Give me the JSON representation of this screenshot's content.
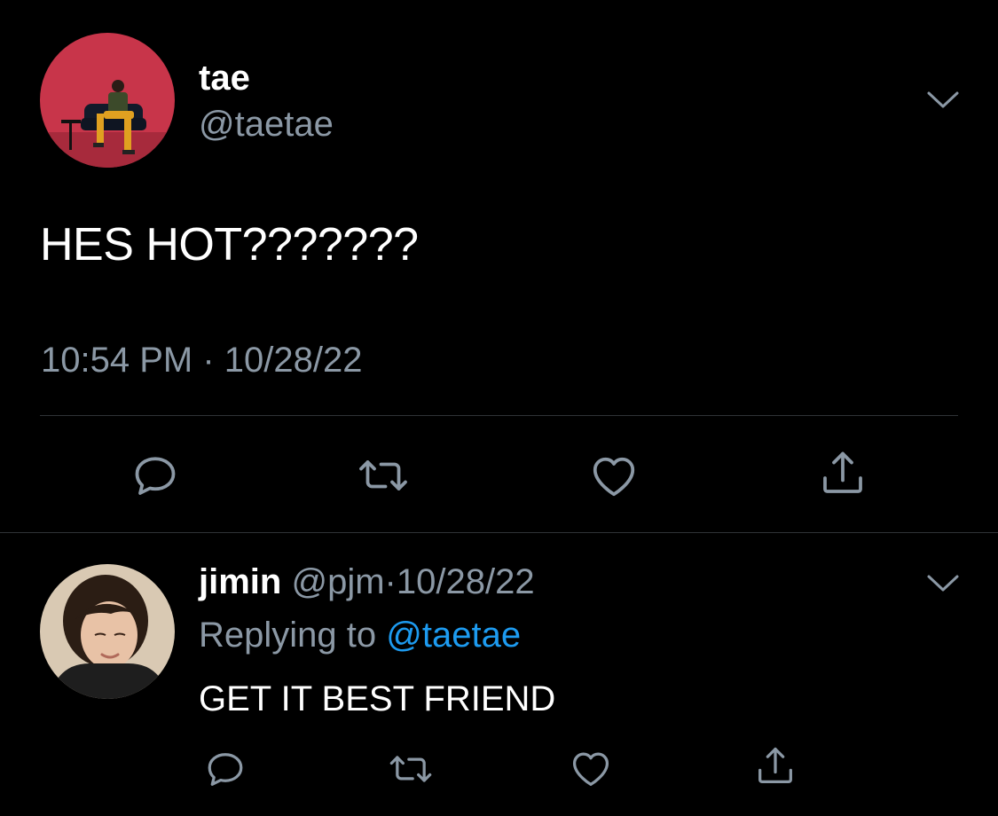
{
  "theme": {
    "background": "#000000",
    "text_primary": "#ffffff",
    "text_secondary": "#8b98a5",
    "accent": "#1d9bf0",
    "divider": "#2f3336"
  },
  "main_tweet": {
    "display_name": "tae",
    "handle": "@taetae",
    "text": "HES HOT???????",
    "timestamp": "10:54 PM · 10/28/22",
    "avatar_icon": "profile-photo",
    "menu_icon": "chevron-down-icon",
    "actions": [
      {
        "name": "reply",
        "icon": "speech-bubble-icon"
      },
      {
        "name": "retweet",
        "icon": "retweet-icon"
      },
      {
        "name": "like",
        "icon": "heart-icon"
      },
      {
        "name": "share",
        "icon": "share-icon"
      }
    ]
  },
  "reply": {
    "display_name": "jimin",
    "handle": "@pjm",
    "separator": "·",
    "date": "10/28/22",
    "replying_prefix": "Replying to",
    "replying_to": "@taetae",
    "text": "GET IT BEST FRIEND",
    "avatar_icon": "profile-photo",
    "menu_icon": "chevron-down-icon",
    "actions": [
      {
        "name": "reply",
        "icon": "speech-bubble-icon"
      },
      {
        "name": "retweet",
        "icon": "retweet-icon"
      },
      {
        "name": "like",
        "icon": "heart-icon"
      },
      {
        "name": "share",
        "icon": "share-icon"
      }
    ]
  }
}
